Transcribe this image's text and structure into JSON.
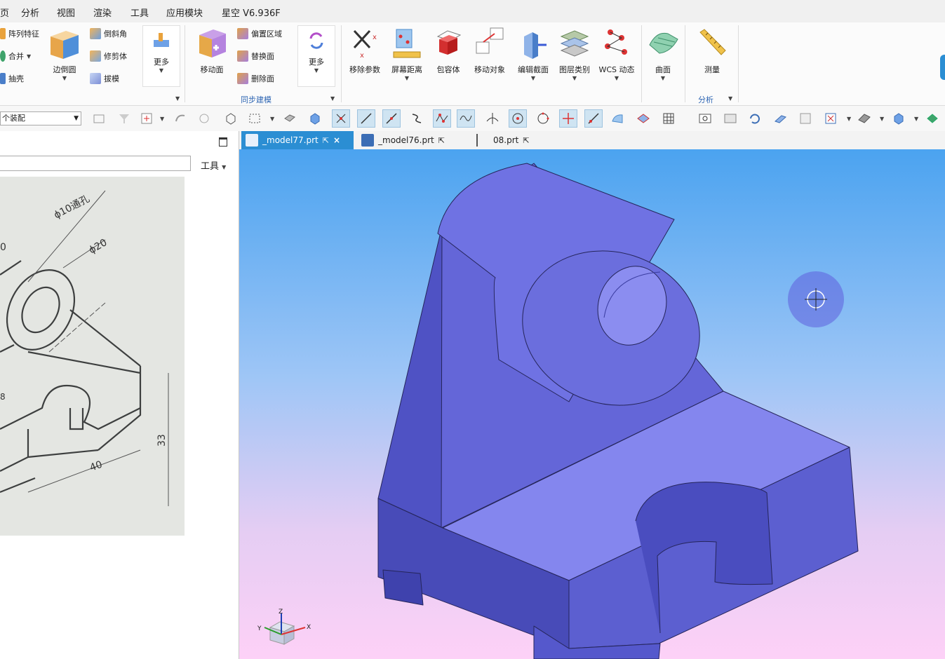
{
  "menu": [
    "页",
    "分析",
    "视图",
    "渲染",
    "工具",
    "应用模块",
    "星空 V6.936F"
  ],
  "ribbon": {
    "feature_group": {
      "array": "阵列特征",
      "unite": "合并",
      "shell": "抽壳",
      "edge_blend": "边倒圆",
      "chamfer": "倒斜角",
      "trim_body": "修剪体",
      "draft": "拔模",
      "more": "更多"
    },
    "sync_group": {
      "move_face": "移动面",
      "offset_region": "偏置区域",
      "replace_face": "替换面",
      "delete_face": "删除面",
      "more": "更多",
      "label": "同步建模"
    },
    "misc": {
      "remove_params": "移除参数",
      "screen_distance": "屏幕距离",
      "bounding_body": "包容体",
      "move_object": "移动对象",
      "edit_section": "编辑截面",
      "layer_category": "图层类别",
      "wcs_dynamic": "WCS 动态",
      "surface": "曲面",
      "measure": "测量",
      "analysis_label": "分析"
    }
  },
  "toolbar2": {
    "filter_value": "个装配"
  },
  "left_panel": {
    "tools_label": "工具",
    "sketch": {
      "hole": "ϕ10通孔",
      "dia20": "ϕ20",
      "d40": "40",
      "d33": "33",
      "d0": "0",
      "d8": "8"
    }
  },
  "tabs": [
    {
      "label": "_model77.prt",
      "active": true
    },
    {
      "label": "_model76.prt",
      "active": false
    },
    {
      "label": "08.prt",
      "active": false
    }
  ],
  "triad": {
    "z": "Z",
    "y": "Y",
    "x": "X"
  },
  "colors": {
    "part_face": "#6466d8",
    "accent": "#2b8ed3",
    "group_label": "#2f66b3"
  }
}
